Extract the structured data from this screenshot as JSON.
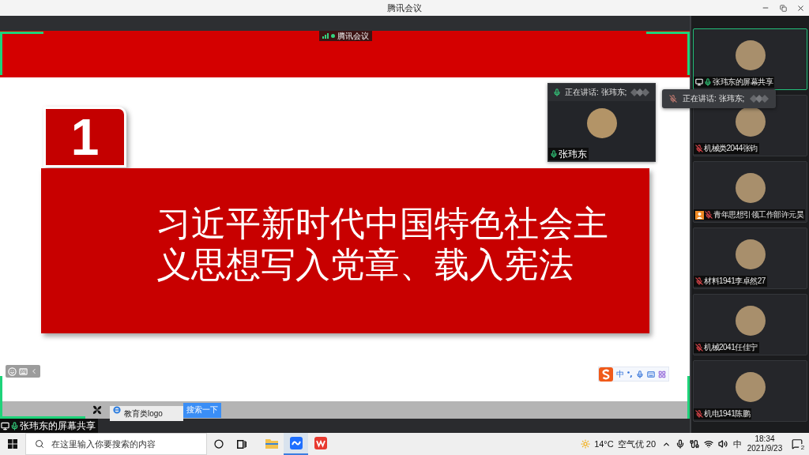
{
  "window": {
    "title": "腾讯会议"
  },
  "shared_screen": {
    "badge": "腾讯会议",
    "slide": {
      "number": "1",
      "title": "习近平新时代中国特色社会主义思想写入党章、载入宪法"
    },
    "speaker_window": {
      "speaking": "正在讲话: 张玮东;",
      "name": "张玮东",
      "muted": false
    },
    "ime_toolbar": {
      "mode": "中"
    },
    "shared_taskbar": {
      "search_value": "教育类logo",
      "search_button": "搜索一下"
    },
    "share_label": "张玮东的屏幕共享"
  },
  "participants": [
    {
      "kind": "screen_share",
      "name": "张玮东的屏幕共享",
      "muted": false,
      "host": false,
      "speaking": true
    },
    {
      "kind": "member",
      "name": "机械类2044张钧",
      "muted": true,
      "host": false,
      "speaking": false
    },
    {
      "kind": "member",
      "name": "青年思想引领工作部许元昊",
      "muted": true,
      "host": true,
      "speaking": false
    },
    {
      "kind": "member",
      "name": "材料1941李卓然27",
      "muted": true,
      "host": false,
      "speaking": false
    },
    {
      "kind": "member",
      "name": "机械2041任佳宁",
      "muted": true,
      "host": false,
      "speaking": false
    },
    {
      "kind": "member",
      "name": "机电1941陈鹏",
      "muted": true,
      "host": false,
      "speaking": false
    }
  ],
  "speaking_tooltip": {
    "text": "正在讲话: 张玮东;"
  },
  "taskbar": {
    "search_placeholder": "在这里输入你要搜索的内容",
    "apps": [
      {
        "kind": "explorer",
        "selected": false
      },
      {
        "kind": "meeting",
        "selected": true
      },
      {
        "kind": "wps",
        "selected": false
      }
    ],
    "weather": "14°C",
    "air_quality": "空气优 20",
    "input_mode": "中",
    "time": "18:34",
    "date": "2021/9/23",
    "notifications": "2"
  }
}
